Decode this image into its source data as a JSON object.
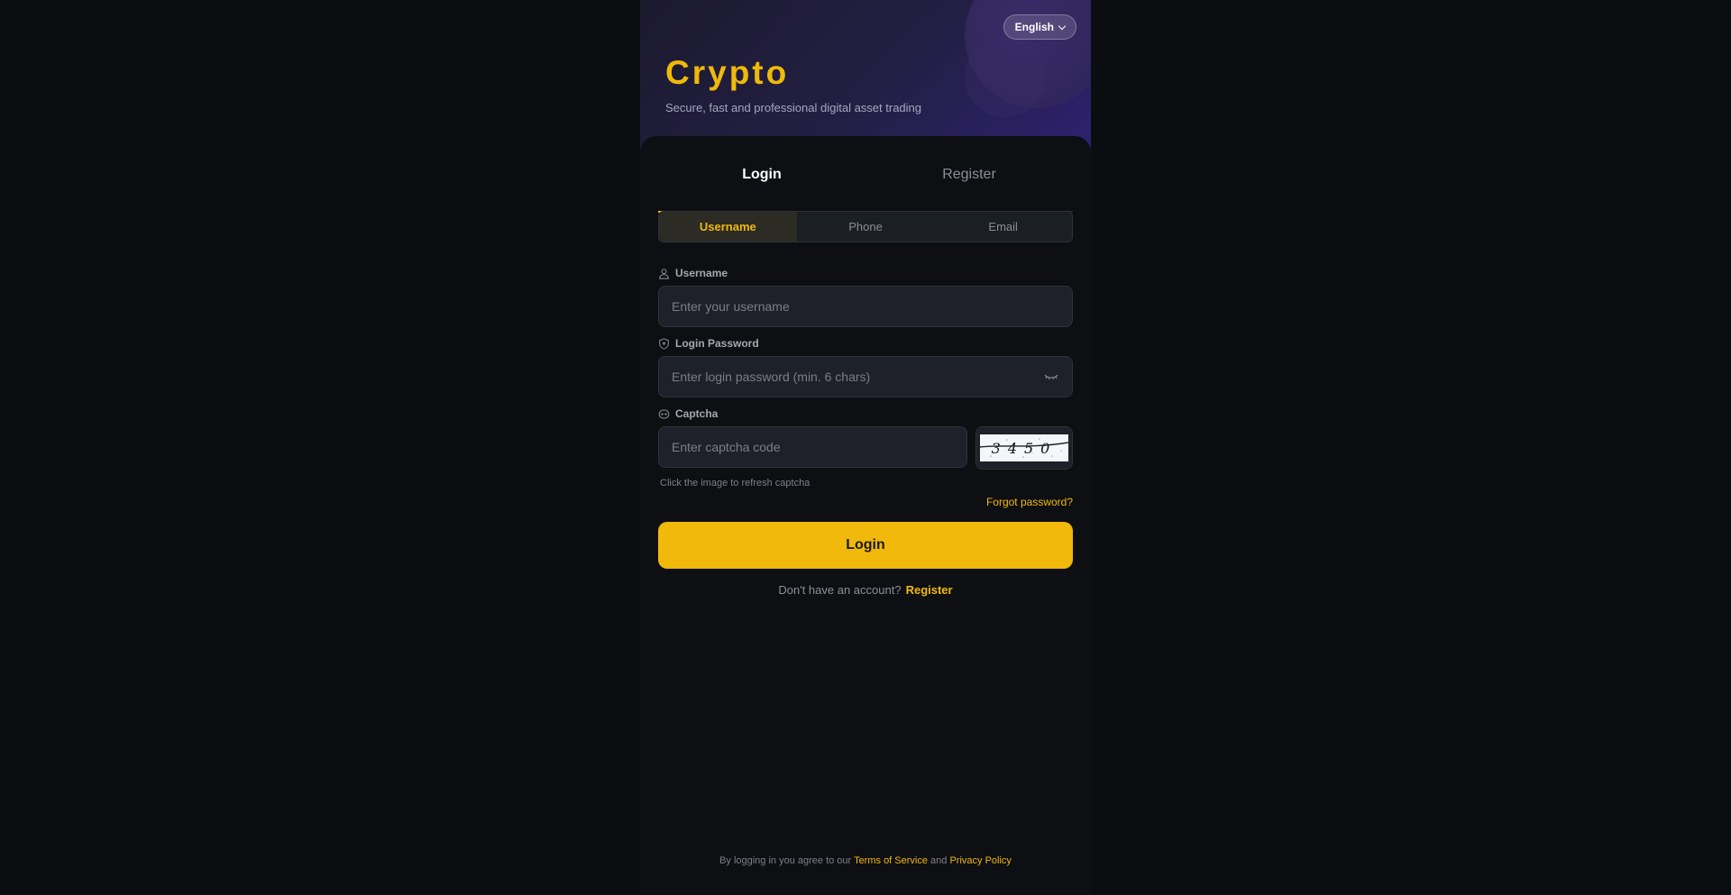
{
  "header": {
    "language": "English",
    "brand": "Crypto",
    "tagline": "Secure, fast and professional digital asset trading"
  },
  "tabs": [
    {
      "label": "Login",
      "active": true
    },
    {
      "label": "Register",
      "active": false
    }
  ],
  "login_methods": [
    {
      "label": "Username",
      "active": true
    },
    {
      "label": "Phone",
      "active": false
    },
    {
      "label": "Email",
      "active": false
    }
  ],
  "fields": {
    "username": {
      "label": "Username",
      "placeholder": "Enter your username",
      "icon": "user-icon"
    },
    "password": {
      "label": "Login Password",
      "placeholder": "Enter login password (min. 6 chars)",
      "icon": "shield-icon",
      "toggle_icon": "eye-closed-icon"
    },
    "captcha": {
      "label": "Captcha",
      "placeholder": "Enter captcha code",
      "icon": "captcha-icon",
      "image_text": "3450",
      "hint": "Click the image to refresh captcha"
    }
  },
  "forgot_password": "Forgot password?",
  "login_button": "Login",
  "signup": {
    "prompt": "Don't have an account?",
    "link": "Register"
  },
  "legal": {
    "prefix": "By logging in you agree to our",
    "terms": "Terms of Service",
    "and": "and",
    "privacy": "Privacy Policy"
  },
  "colors": {
    "accent": "#f0b90b",
    "background": "#0c0d10",
    "hero": "#2e2170"
  }
}
